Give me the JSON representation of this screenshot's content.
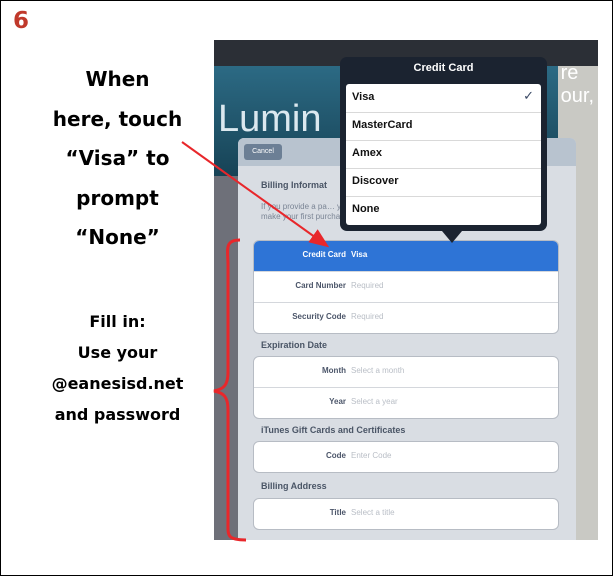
{
  "step_number": "6",
  "instructions": {
    "main_lines": [
      "When",
      "here, touch",
      "“Visa” to",
      "prompt",
      "“None”"
    ],
    "fill_lines": [
      "Fill in:",
      "Use your",
      "@eanesisd.net",
      "and password"
    ]
  },
  "colors": {
    "step_number": "#c0392b",
    "arrow": "#e8272b",
    "selected_row": "#2e74d6",
    "popover": "#1b2330"
  },
  "screenshot": {
    "background": {
      "hero_text": "Lumin",
      "right_text": "re",
      "right_small": "our,"
    },
    "sheet": {
      "cancel_label": "Cancel",
      "billing_heading": "Billing Informat",
      "billing_desc": "If you provide a pa… you make a purcha… provide a payment method when you make your first purchase.",
      "rows_card": [
        {
          "label": "Credit Card",
          "value": "Visa",
          "selected": true
        },
        {
          "label": "Card Number",
          "value": "Required"
        },
        {
          "label": "Security Code",
          "value": "Required"
        }
      ],
      "expiration_heading": "Expiration Date",
      "rows_exp": [
        {
          "label": "Month",
          "value": "Select a month"
        },
        {
          "label": "Year",
          "value": "Select a year"
        }
      ],
      "gift_heading": "iTunes Gift Cards and Certificates",
      "rows_gift": [
        {
          "label": "Code",
          "value": "Enter Code"
        }
      ],
      "address_heading": "Billing Address",
      "rows_addr": [
        {
          "label": "Title",
          "value": "Select a title"
        }
      ]
    },
    "popover": {
      "title": "Credit Card",
      "options": [
        "Visa",
        "MasterCard",
        "Amex",
        "Discover",
        "None"
      ],
      "selected_index": 0,
      "check_icon": "✓"
    }
  }
}
